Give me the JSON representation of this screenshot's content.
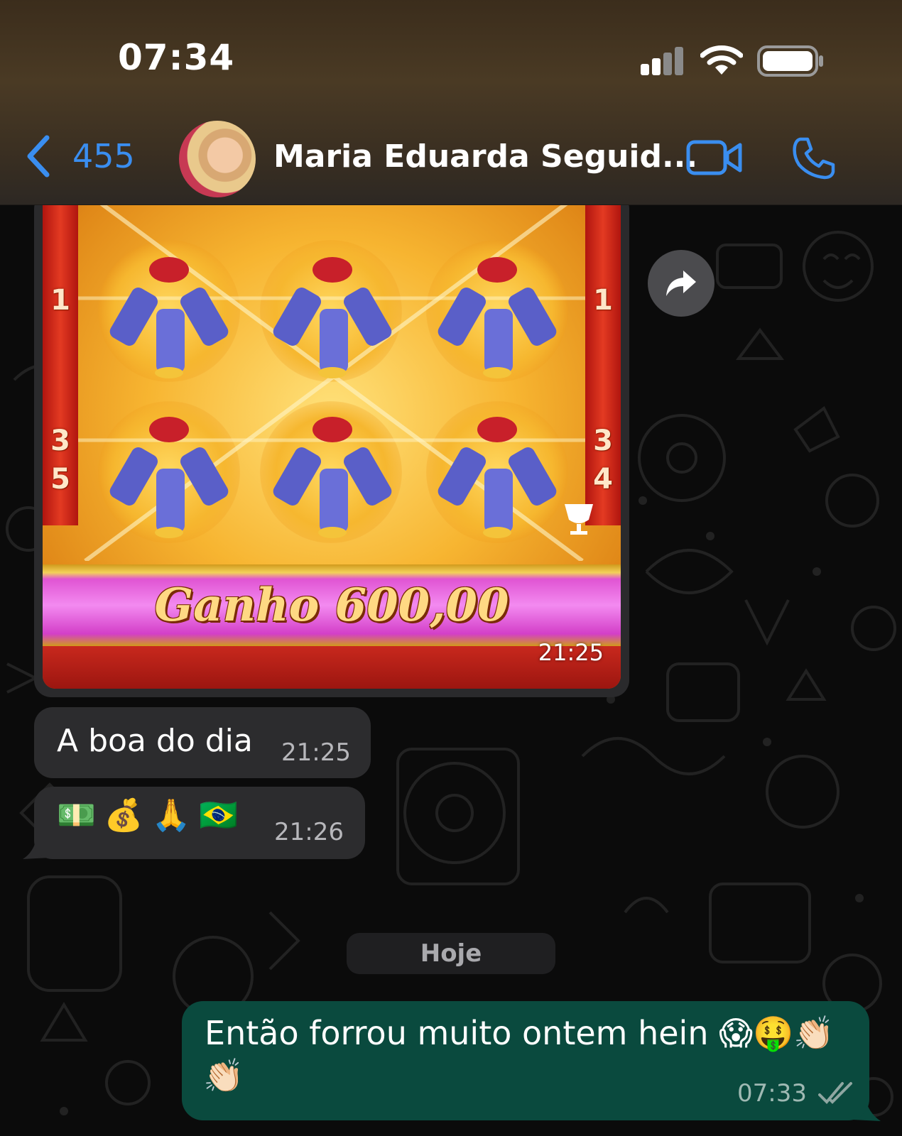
{
  "status_bar": {
    "time": "07:34"
  },
  "header": {
    "back_count": "455",
    "contact_name": "Maria Eduarda Seguid...",
    "accent_color": "#3a8ef0"
  },
  "icons": [
    "back-chevron-icon",
    "video-camera-icon",
    "phone-icon",
    "forward-icon",
    "read-ticks-icon",
    "signal-icon",
    "wifi-icon",
    "battery-icon"
  ],
  "messages": [
    {
      "type": "image",
      "direction": "incoming",
      "image": {
        "left_rail": [
          "1",
          "3",
          "5"
        ],
        "right_rail": [
          "1",
          "3",
          "4"
        ],
        "banner": "Ganho 600,00"
      },
      "time": "21:25"
    },
    {
      "type": "text",
      "direction": "incoming",
      "text": "A boa do dia",
      "time": "21:25"
    },
    {
      "type": "text",
      "direction": "incoming",
      "text": "💵💰🙏🇧🇷",
      "time": "21:26"
    },
    {
      "type": "date",
      "label": "Hoje"
    },
    {
      "type": "text",
      "direction": "outgoing",
      "line1": "Então forrou muito ontem hein 😱🤑👏🏻",
      "line2": "👏🏻",
      "time": "07:33",
      "status": "read",
      "bubble_color": "#0a4a3e"
    }
  ]
}
